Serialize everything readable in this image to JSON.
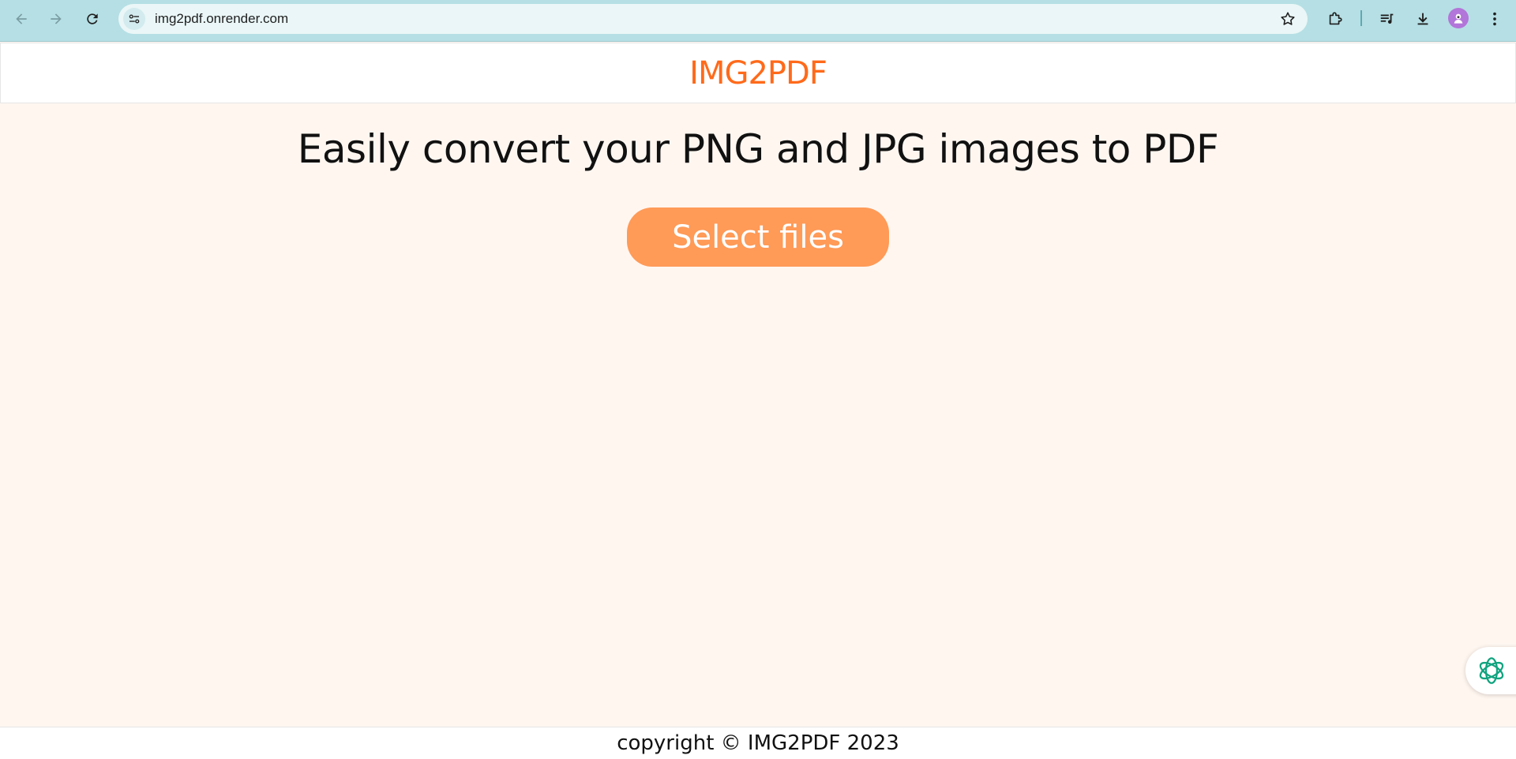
{
  "browser": {
    "url": "img2pdf.onrender.com",
    "back_icon": "arrow-left-icon",
    "forward_icon": "arrow-right-icon",
    "reload_icon": "reload-icon",
    "site_info_icon": "tune-icon",
    "bookmark_icon": "star-icon",
    "extensions_icon": "puzzle-icon",
    "media_icon": "playlist-icon",
    "downloads_icon": "download-icon",
    "profile_icon": "avatar-icon",
    "menu_icon": "kebab-menu-icon",
    "chrome_color": "#b5dfe4"
  },
  "header": {
    "brand": "IMG2PDF",
    "brand_color": "#ff6a1a"
  },
  "main": {
    "headline": "Easily convert your PNG and JPG images to PDF",
    "select_button": "Select files",
    "button_color": "#ff9a57",
    "background": "#fff6f0"
  },
  "floating": {
    "icon": "openai-logo-icon"
  },
  "footer": {
    "text": "copyright © IMG2PDF 2023"
  }
}
